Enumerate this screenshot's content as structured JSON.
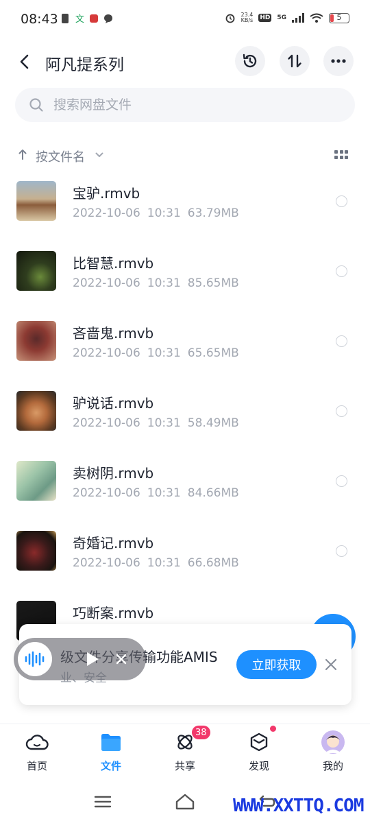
{
  "status_bar": {
    "time": "08:43",
    "net_speed_value": "23.4",
    "net_speed_unit": "KB/s",
    "hd": "HD",
    "network": "5G",
    "battery": "5"
  },
  "header": {
    "title": "阿凡提系列",
    "icons": [
      "back-arrow-icon",
      "history-icon",
      "sort-icon",
      "more-icon"
    ]
  },
  "search": {
    "placeholder": "搜索网盘文件"
  },
  "sort": {
    "label": "按文件名"
  },
  "files": [
    {
      "name": "宝驴.rmvb",
      "date": "2022-10-06",
      "time": "10:31",
      "size": "63.79MB"
    },
    {
      "name": "比智慧.rmvb",
      "date": "2022-10-06",
      "time": "10:31",
      "size": "85.65MB"
    },
    {
      "name": "吝啬鬼.rmvb",
      "date": "2022-10-06",
      "time": "10:31",
      "size": "65.65MB"
    },
    {
      "name": "驴说话.rmvb",
      "date": "2022-10-06",
      "time": "10:31",
      "size": "58.49MB"
    },
    {
      "name": "卖树阴.rmvb",
      "date": "2022-10-06",
      "time": "10:31",
      "size": "84.66MB"
    },
    {
      "name": "奇婚记.rmvb",
      "date": "2022-10-06",
      "time": "10:31",
      "size": "66.68MB"
    },
    {
      "name": "巧断案.rmvb",
      "date": "",
      "time": "",
      "size": ""
    }
  ],
  "banner": {
    "title": "级文件分享传输功能AMIS",
    "subtitle": "业、安全",
    "cta": "立即获取"
  },
  "bottom_nav": {
    "items": [
      {
        "label": "首页",
        "icon": "cloud-home-icon"
      },
      {
        "label": "文件",
        "icon": "folder-icon"
      },
      {
        "label": "共享",
        "icon": "share-atom-icon"
      },
      {
        "label": "发现",
        "icon": "cube-icon"
      },
      {
        "label": "我的",
        "icon": "avatar-icon"
      }
    ],
    "share_badge": "38",
    "active": "文件"
  },
  "watermark": "WWW.XXTTQ.COM",
  "colors": {
    "accent": "#1e90ff",
    "badge": "#f2386b",
    "text": "#1f2430",
    "muted": "#a3a8b2"
  }
}
